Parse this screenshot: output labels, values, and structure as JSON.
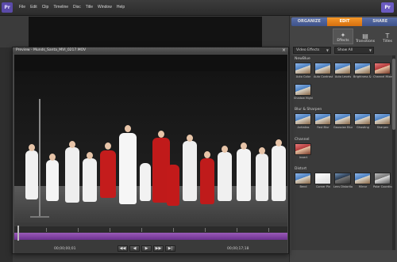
{
  "app": {
    "logo_text": "",
    "menu": [
      "File",
      "Edit",
      "Clip",
      "Timeline",
      "Disc",
      "Title",
      "Window",
      "Help"
    ]
  },
  "workspace_tabs": {
    "organize": "ORGANIZE",
    "edit": "EDIT",
    "share": "SHARE"
  },
  "edit_subtabs": [
    {
      "label": "Effects",
      "icon": "effects-icon"
    },
    {
      "label": "Transitions",
      "icon": "transitions-icon"
    },
    {
      "label": "Titles",
      "icon": "titles-icon"
    }
  ],
  "filters": {
    "category": "Video Effects",
    "show": "Show All"
  },
  "effects": {
    "sections": [
      {
        "name": "NewBlue",
        "items": [
          "Auto Color",
          "Auto Contrast",
          "Auto Levels",
          "Brightness & Contrast",
          "Channel Mixer",
          "Shadow Highlight"
        ]
      },
      {
        "name": "Blur & Sharpen",
        "items": [
          "Antialias",
          "Fast Blur",
          "Gaussian Blur",
          "Ghosting",
          "Sharpen"
        ]
      },
      {
        "name": "Channel",
        "items": [
          "Invert"
        ]
      },
      {
        "name": "Distort",
        "items": [
          "Bend",
          "Corner Pin",
          "Lens Distortion",
          "Mirror",
          "Polar Coordinates"
        ]
      }
    ]
  },
  "preview": {
    "title": "Preview - Munds_Santa_MVI_0217.MOV",
    "time_current": "00;00;00;01",
    "time_total": "00;00;17;18"
  },
  "transport": {
    "buttons": [
      "◀◀",
      "◀",
      "▶",
      "▶▶",
      "▶|"
    ]
  }
}
